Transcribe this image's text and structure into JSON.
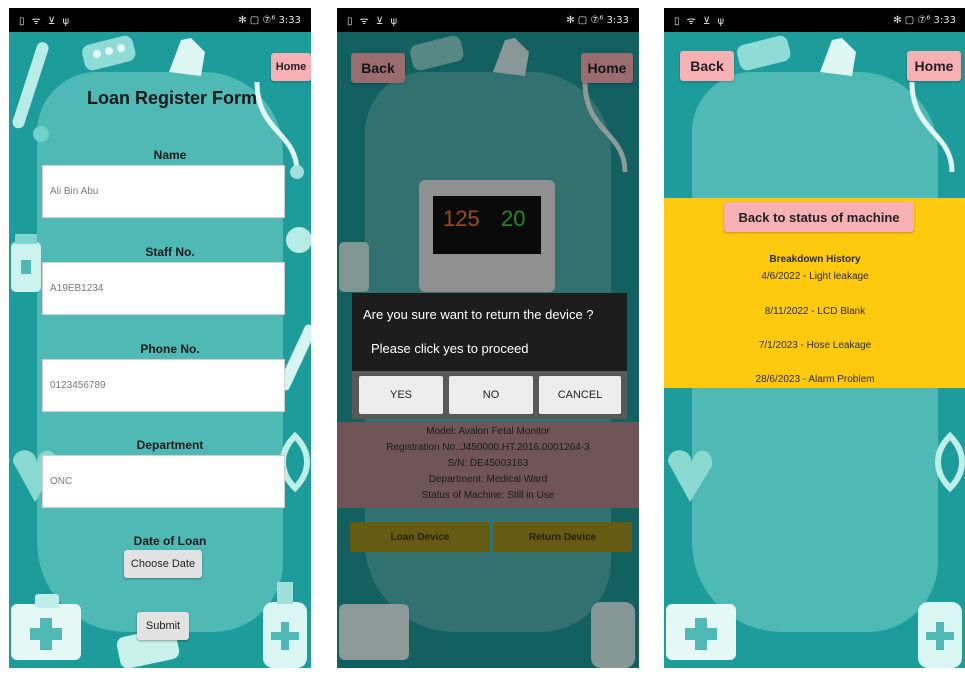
{
  "status_bar": {
    "left_icons": "▯ ᯤ ⊻ ψ",
    "right_text": "✻ ▢ ⑦⁶ 3:33"
  },
  "screen1": {
    "home_label": "Home",
    "form_title": "Loan Register Form",
    "name_label": "Name",
    "name_value": "Ali Bin Abu",
    "staff_label": "Staff No.",
    "staff_value": "A19EB1234",
    "phone_label": "Phone No.",
    "phone_value": "0123456789",
    "dept_label": "Department",
    "dept_value": "ONC",
    "date_label": "Date of Loan",
    "choose_date_label": "Choose Date",
    "submit_label": "Submit"
  },
  "screen2": {
    "back_label": "Back",
    "home_label": "Home",
    "monitor_reading_1": "125",
    "monitor_reading_2": "20",
    "dialog_message": "Are you sure want to return the device ?",
    "dialog_sub": "Please click yes to proceed",
    "yes_label": "YES",
    "no_label": "NO",
    "cancel_label": "CANCEL",
    "info": {
      "model": "Model: Avalon Fetal Monitor",
      "registration": "Registration No.:J450000.HT.2016.0001264-3",
      "serial": "S/N: DE45003163",
      "department": "Department: Medical Ward",
      "status": "Status of Machine: Still in Use"
    },
    "loan_device_label": "Loan Device",
    "return_device_label": "Return Device"
  },
  "screen3": {
    "back_label": "Back",
    "home_label": "Home",
    "status_button_label": "Back to status of machine",
    "history_title": "Breakdown History",
    "history_items": [
      "4/6/2022 - Light leakage",
      "8/11/2022 - LCD Blank",
      "7/1/2023 - Hose Leakage",
      "28/6/2023 - Alarm Problem"
    ]
  },
  "colors": {
    "teal_bg": "#1d9c9c",
    "teal_blob": "#4fb9b6",
    "button_pink": "#f7b0b4",
    "history_yellow": "#ffc90e",
    "device_info_rose": "#b58a8f",
    "device_button_olive": "#a39320"
  }
}
